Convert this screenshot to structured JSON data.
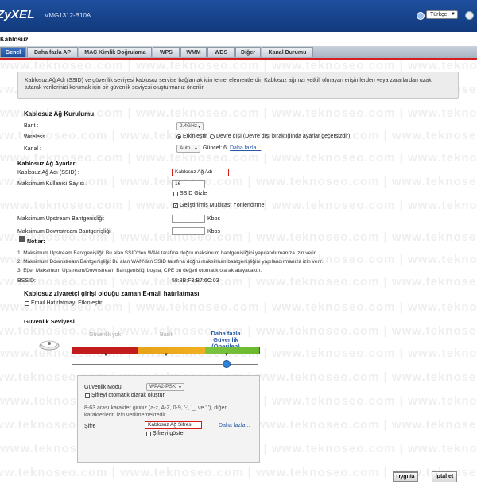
{
  "header": {
    "brand": "ZyXEL",
    "model": "VMG1312-B10A",
    "language": "Türkçe"
  },
  "page_title": "Kablosuz",
  "tabs": [
    {
      "label": "Genel",
      "active": true
    },
    {
      "label": "Daha fazla AP",
      "active": false
    },
    {
      "label": "MAC Kimlik Doğrulama",
      "active": false
    },
    {
      "label": "WPS",
      "active": false
    },
    {
      "label": "WMM",
      "active": false
    },
    {
      "label": "WDS",
      "active": false
    },
    {
      "label": "Diğer",
      "active": false
    },
    {
      "label": "Kanal Durumu",
      "active": false
    }
  ],
  "info": {
    "line1": "Kablosuz Ağ Adı (SSID) ve güvenlik seviyesi kablosuz servise bağlamak için temel elementlerdir. Kablosuz ağınızı yetkili olmayan erişimlerden veya zararlardan uzak",
    "line2": "tutarak verilerinizi korumak için bir güvenlik seviyesi oluşturmanız önerilir."
  },
  "setup": {
    "title": "Kablosuz Ağ Kurulumu",
    "band_label": "Bant :",
    "band_value": "2.4GHz",
    "wireless_label": "Wireless",
    "enable_label": "Etkinleştir",
    "disable_label": "Devre dışı (Devre dışı bıraktığında ayarlar geçersizdir)",
    "channel_label": "Kanal :",
    "channel_value": "Auto",
    "current_channel": "Güncel: 6",
    "more_link": "Daha fazla..."
  },
  "network": {
    "title": "Kablosuz Ağ Ayarları",
    "ssid_label": "Kablosuz Ağ Adı (SSID) :",
    "ssid_value": "Kablosuz Ağ Adı",
    "max_clients_label": "Maksimum Kullanıcı Sayısı :",
    "max_clients_value": "16",
    "hide_ssid_label": "SSID Gizle",
    "multicast_label": "Geliştirilmiş Multicast Yönlendirme",
    "upstream_label": "Maksimum Upstream Bantgenişliği:",
    "downstream_label": "Maksimum Downstream Bantgenişliği:",
    "kbps": "Kbps",
    "notes_title": "Notlar:",
    "notes": [
      "1. Maksimum Upstream Bantgenişliği: Bu alan SSID'den WAN tarafına doğru maksimum bantgenişliğini yapılandırmanıza izin verir.",
      "2. Maksimum Downstream Bantgenişliği: Bu alan WAN'dan SSID tarafına doğru maksimum bantgenişliğini yapılandırmanıza izin verir.",
      "3. Eğer Maksimum Upstream/Downstream Bantgenişliği boşsa, CPE bu değeri otomatik olarak atayacaktır."
    ],
    "bssid_label": "BSSID:",
    "bssid_value": "58:8B:F3:B7:6C:03"
  },
  "guest": {
    "title": "Kablosuz ziyaretçi girişi olduğu zaman E-mail hatırlatması",
    "email_label": "Email Hatırlatmayı Etkinleştir"
  },
  "security": {
    "title": "Güvenlik Seviyesi",
    "level_low": "Güvenlik yok",
    "level_basic": "Basit",
    "level_high": [
      "Daha fazla",
      "Güvenlik",
      "(Önerilen)"
    ],
    "selected_level": 1.0,
    "mode_label": "Güvenlik Modu:",
    "mode_value": "WPA2-PSK",
    "auto_gen_label": "Şifreyi otomatik olarak oluştur",
    "hint1": "8-63 arası karakter giriniz (a-z, A-Z, 0-9, '-', '_' ve '.'), diğer",
    "hint2": "karakterlerin izin verilmemektedir.",
    "password_label": "Şifre",
    "password_value": "Kablosuz Ağ Şifresi",
    "show_password_label": "Şifreyi göster",
    "more_link": "Daha fazla..."
  },
  "actions": {
    "apply": "Uygula",
    "cancel": "İptal et"
  },
  "watermark": "www.teknoseo.com | www.teknoseo.com | www.teknoseo.com | www.teknoseo.com",
  "colors": {
    "header_blue": "#1a4690",
    "highlight_red": "#d91818",
    "level_red": "#c21c1c",
    "level_amber": "#f0b020",
    "level_green": "#6bb82e"
  }
}
